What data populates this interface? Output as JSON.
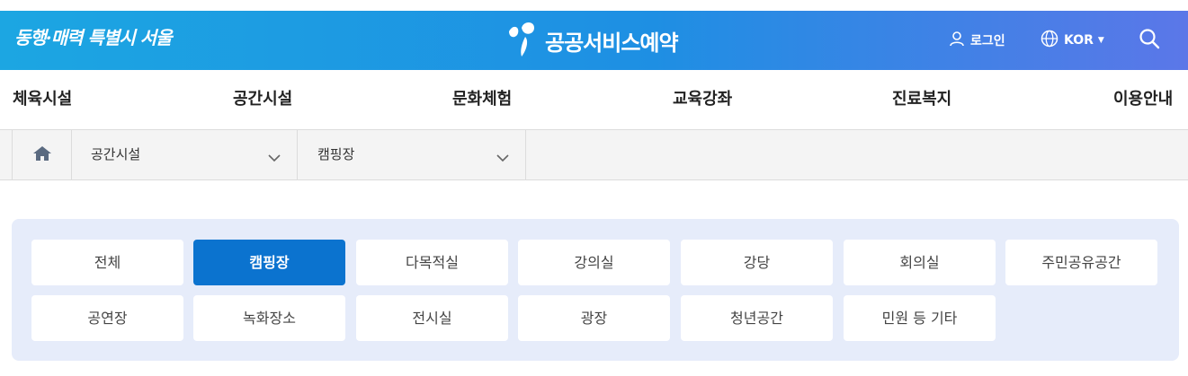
{
  "header": {
    "city_slogan": "동행·매력 특별시 서울",
    "brand_title": "공공서비스예약",
    "login_label": "로그인",
    "language_label": "KOR",
    "gradient_colors": [
      "#1ca6e2",
      "#1e8fe3",
      "#5b77e8"
    ],
    "icons": {
      "brand": "sprout-person-icon",
      "login": "user-icon",
      "language": "globe-icon",
      "search": "search-icon"
    }
  },
  "gnb": {
    "items": [
      "체육시설",
      "공간시설",
      "문화체험",
      "교육강좌",
      "진료복지",
      "이용안내"
    ]
  },
  "location": {
    "home_icon": "home-icon",
    "category": "공간시설",
    "subcategory": "캠핑장"
  },
  "tabs": {
    "accent_color": "#0b73cf",
    "row1": [
      "전체",
      "캠핑장",
      "다목적실",
      "강의실",
      "강당",
      "회의실",
      "주민공유공간"
    ],
    "row2": [
      "공연장",
      "녹화장소",
      "전시실",
      "광장",
      "청년공간",
      "민원 등 기타"
    ],
    "active": "캠핑장"
  }
}
